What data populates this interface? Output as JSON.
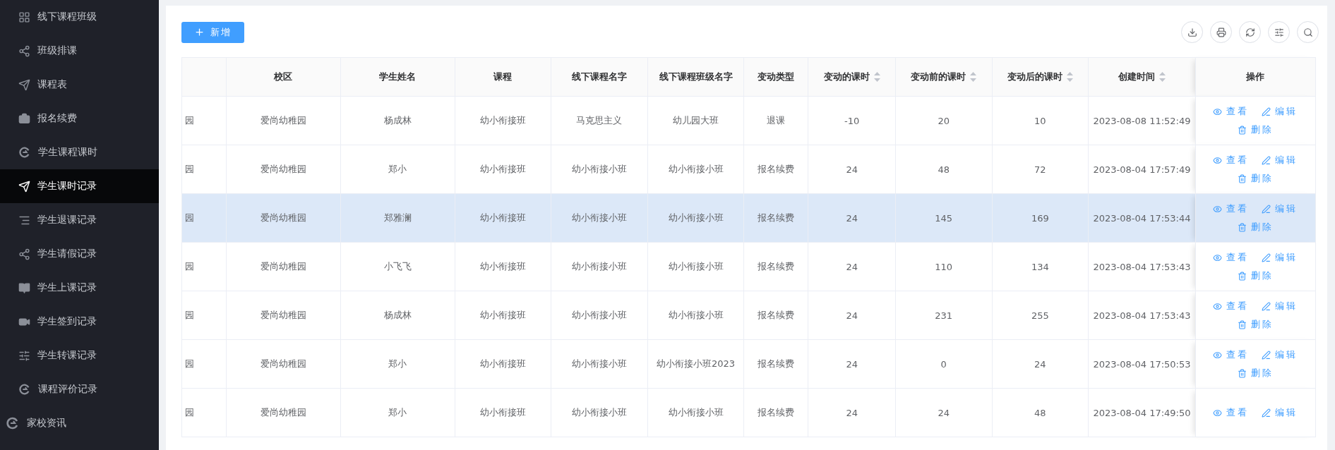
{
  "sidebar": {
    "items": [
      {
        "label": "线下课程班级",
        "selected": false
      },
      {
        "label": "班级排课",
        "selected": false
      },
      {
        "label": "课程表",
        "selected": false
      },
      {
        "label": "报名续费",
        "selected": false
      },
      {
        "label": "学生课程课时",
        "selected": false
      },
      {
        "label": "学生课时记录",
        "selected": true
      },
      {
        "label": "学生退课记录",
        "selected": false
      },
      {
        "label": "学生请假记录",
        "selected": false
      },
      {
        "label": "学生上课记录",
        "selected": false
      },
      {
        "label": "学生签到记录",
        "selected": false
      },
      {
        "label": "学生转课记录",
        "selected": false
      },
      {
        "label": "课程评价记录",
        "selected": false
      }
    ],
    "section": {
      "label": "家校资讯"
    }
  },
  "toolbar": {
    "add_button": "新增"
  },
  "table": {
    "columns": [
      {
        "sortable": false
      },
      {
        "label": "校区",
        "sortable": false
      },
      {
        "label": "学生姓名",
        "sortable": false
      },
      {
        "label": "课程",
        "sortable": false
      },
      {
        "label": "线下课程名字",
        "sortable": false
      },
      {
        "label": "线下课程班级名字",
        "sortable": false
      },
      {
        "label": "变动类型",
        "sortable": false
      },
      {
        "label": "变动的课时",
        "sortable": true
      },
      {
        "label": "变动前的课时",
        "sortable": true
      },
      {
        "label": "变动后的课时",
        "sortable": true
      },
      {
        "label": "创建时间",
        "sortable": true
      },
      {
        "label": "操作",
        "sortable": false
      }
    ],
    "rows": [
      {
        "highlighted": false,
        "cells": [
          "园",
          "爱尚幼稚园",
          "杨成林",
          "幼小衔接班",
          "马克思主义",
          "幼儿园大班",
          "退课",
          "-10",
          "20",
          "10",
          "2023-08-08 11:52:49"
        ],
        "actions": [
          {
            "kind": "view",
            "label": "查看"
          },
          {
            "kind": "edit",
            "label": "编辑"
          },
          {
            "kind": "delete",
            "label": "删除"
          }
        ]
      },
      {
        "highlighted": false,
        "cells": [
          "园",
          "爱尚幼稚园",
          "郑小",
          "幼小衔接班",
          "幼小衔接小班",
          "幼小衔接小班",
          "报名续费",
          "24",
          "48",
          "72",
          "2023-08-04 17:57:49"
        ],
        "actions": [
          {
            "kind": "view",
            "label": "查看"
          },
          {
            "kind": "edit",
            "label": "编辑"
          },
          {
            "kind": "delete",
            "label": "删除"
          }
        ]
      },
      {
        "highlighted": true,
        "cells": [
          "园",
          "爱尚幼稚园",
          "郑雅澜",
          "幼小衔接班",
          "幼小衔接小班",
          "幼小衔接小班",
          "报名续费",
          "24",
          "145",
          "169",
          "2023-08-04 17:53:44"
        ],
        "actions": [
          {
            "kind": "view",
            "label": "查看"
          },
          {
            "kind": "edit",
            "label": "编辑"
          },
          {
            "kind": "delete",
            "label": "删除"
          }
        ]
      },
      {
        "highlighted": false,
        "cells": [
          "园",
          "爱尚幼稚园",
          "小飞飞",
          "幼小衔接班",
          "幼小衔接小班",
          "幼小衔接小班",
          "报名续费",
          "24",
          "110",
          "134",
          "2023-08-04 17:53:43"
        ],
        "actions": [
          {
            "kind": "view",
            "label": "查看"
          },
          {
            "kind": "edit",
            "label": "编辑"
          },
          {
            "kind": "delete",
            "label": "删除"
          }
        ]
      },
      {
        "highlighted": false,
        "cells": [
          "园",
          "爱尚幼稚园",
          "杨成林",
          "幼小衔接班",
          "幼小衔接小班",
          "幼小衔接小班",
          "报名续费",
          "24",
          "231",
          "255",
          "2023-08-04 17:53:43"
        ],
        "actions": [
          {
            "kind": "view",
            "label": "查看"
          },
          {
            "kind": "edit",
            "label": "编辑"
          },
          {
            "kind": "delete",
            "label": "删除"
          }
        ]
      },
      {
        "highlighted": false,
        "cells": [
          "园",
          "爱尚幼稚园",
          "郑小",
          "幼小衔接班",
          "幼小衔接小班",
          "幼小衔接小班2023",
          "报名续费",
          "24",
          "0",
          "24",
          "2023-08-04 17:50:53"
        ],
        "actions": [
          {
            "kind": "view",
            "label": "查看"
          },
          {
            "kind": "edit",
            "label": "编辑"
          },
          {
            "kind": "delete",
            "label": "删除"
          }
        ]
      },
      {
        "highlighted": false,
        "cells": [
          "园",
          "爱尚幼稚园",
          "郑小",
          "幼小衔接班",
          "幼小衔接小班",
          "幼小衔接小班",
          "报名续费",
          "24",
          "24",
          "48",
          "2023-08-04 17:49:50"
        ],
        "actions": [
          {
            "kind": "view",
            "label": "查看"
          },
          {
            "kind": "edit",
            "label": "编辑"
          }
        ]
      }
    ]
  }
}
